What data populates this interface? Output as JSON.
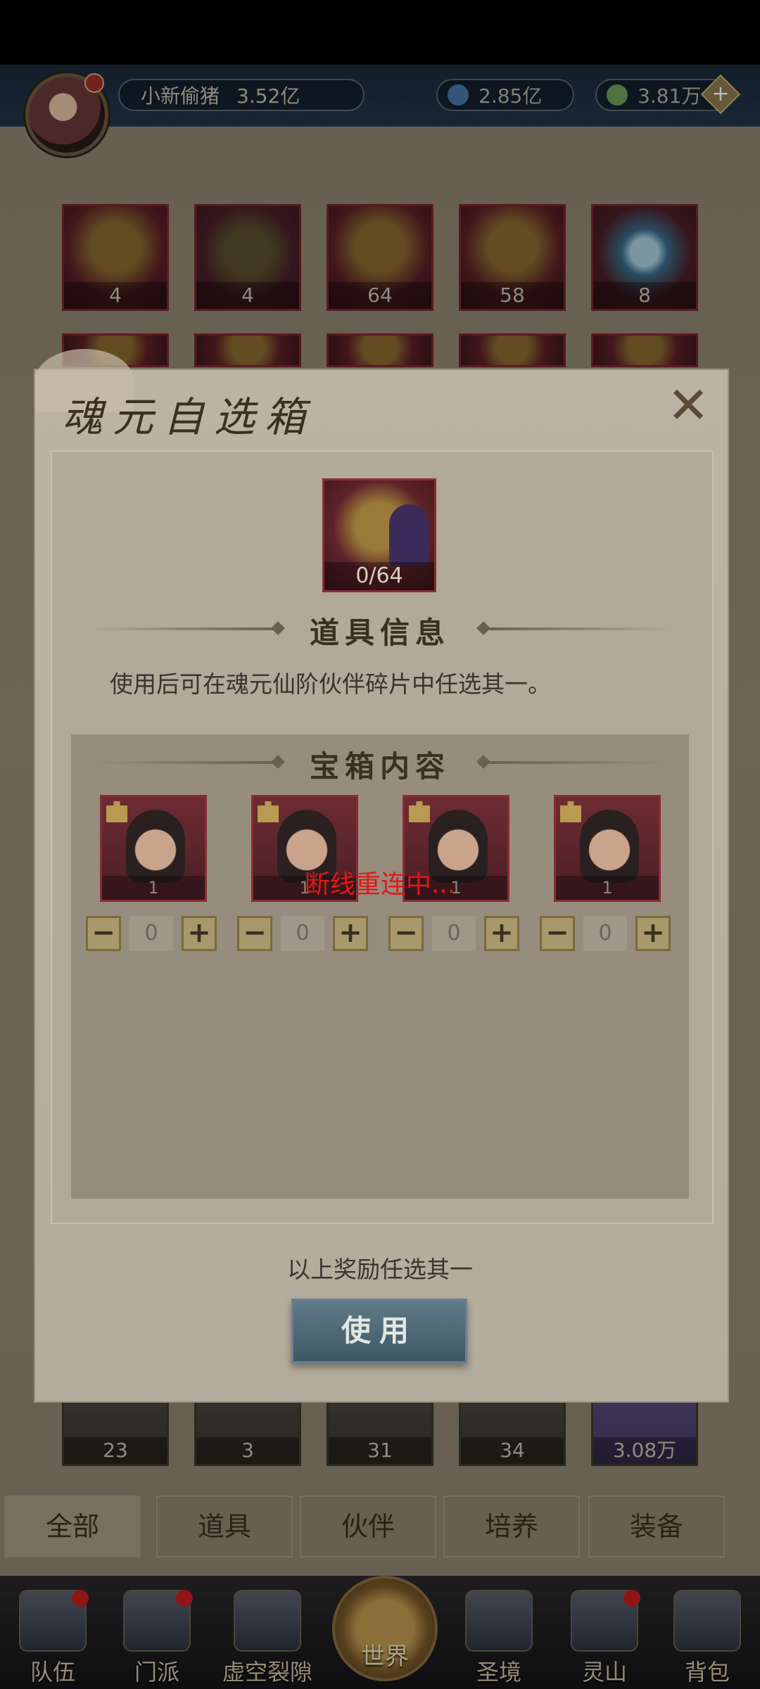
{
  "header": {
    "player_name": "小新偷猪",
    "power": "3.52亿",
    "resource1": "2.85亿",
    "resource2": "3.81万",
    "plus": "+"
  },
  "inventory": {
    "row1_counts": [
      "4",
      "4",
      "64",
      "58",
      "8"
    ],
    "bottom_counts": [
      "23",
      "3",
      "31",
      "34",
      "3.08万"
    ]
  },
  "filter_tabs": [
    "全部",
    "道具",
    "伙伴",
    "培养",
    "装备"
  ],
  "bottom_nav": [
    "队伍",
    "门派",
    "虚空裂隙",
    "世界",
    "圣境",
    "灵山",
    "背包"
  ],
  "modal": {
    "title": "魂元自选箱",
    "close": "✕",
    "item_count": "0/64",
    "info_header": "道具信息",
    "description": "使用后可在魂元仙阶伙伴碎片中任选其一。",
    "contents_header": "宝箱内容",
    "rewards": [
      {
        "count": "1",
        "qty": "0"
      },
      {
        "count": "1",
        "qty": "0"
      },
      {
        "count": "1",
        "qty": "0"
      },
      {
        "count": "1",
        "qty": "0"
      }
    ],
    "reconnecting": "断线重连中...",
    "note": "以上奖励任选其一",
    "use_button": "使用",
    "minus": "−",
    "plus": "+"
  },
  "colors": {
    "accent_red": "#e01818",
    "frame_red": "#8a2b36",
    "button_blue": "#4f6a78"
  }
}
